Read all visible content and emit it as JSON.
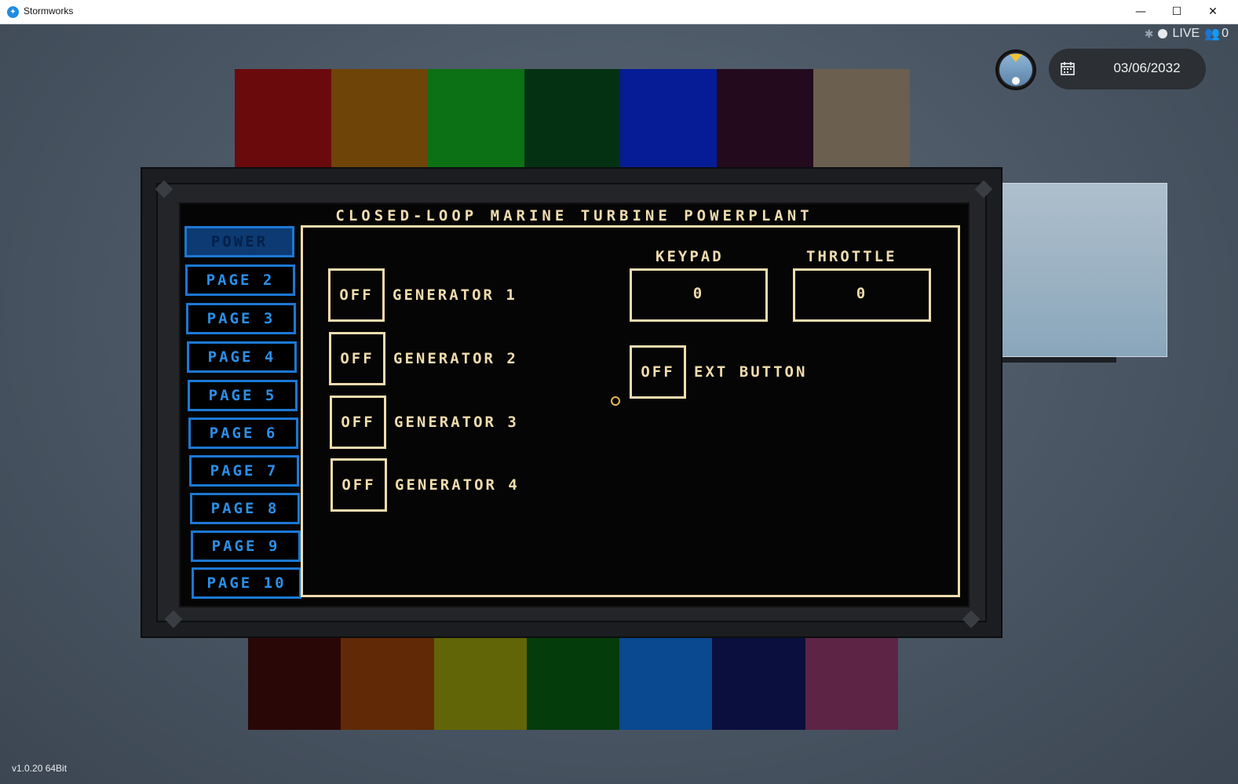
{
  "window": {
    "title": "Stormworks",
    "minimize_glyph": "—",
    "maximize_glyph": "☐",
    "close_glyph": "✕"
  },
  "hud": {
    "live_label": "LIVE",
    "players_count": "0",
    "date": "03/06/2032"
  },
  "version": "v1.0.20 64Bit",
  "colors": {
    "top_strip": [
      "#6a0a0d",
      "#6e4409",
      "#0c7114",
      "#053113",
      "#061c96",
      "#230a1c",
      "#6b5f50"
    ],
    "bottom_strip": [
      "#2a0707",
      "#612906",
      "#616508",
      "#053c0b",
      "#0a4890",
      "#0b0f3e",
      "#5d2446"
    ],
    "screen_accent": "#f0dcae",
    "nav_accent": "#1c78d4"
  },
  "screen": {
    "title": "CLOSED-LOOP MARINE TURBINE POWERPLANT",
    "nav": [
      {
        "label": "POWER"
      },
      {
        "label": "PAGE 2"
      },
      {
        "label": "PAGE 3"
      },
      {
        "label": "PAGE 4"
      },
      {
        "label": "PAGE 5"
      },
      {
        "label": "PAGE 6"
      },
      {
        "label": "PAGE 7"
      },
      {
        "label": "PAGE 8"
      },
      {
        "label": "PAGE 9"
      },
      {
        "label": "PAGE 10"
      }
    ],
    "generators": [
      {
        "state": "OFF",
        "label": "GENERATOR 1"
      },
      {
        "state": "OFF",
        "label": "GENERATOR 2"
      },
      {
        "state": "OFF",
        "label": "GENERATOR 3"
      },
      {
        "state": "OFF",
        "label": "GENERATOR 4"
      }
    ],
    "keypad": {
      "label": "KEYPAD",
      "value": "0"
    },
    "throttle": {
      "label": "THROTTLE",
      "value": "0"
    },
    "ext": {
      "state": "OFF",
      "label": "EXT BUTTON"
    }
  }
}
